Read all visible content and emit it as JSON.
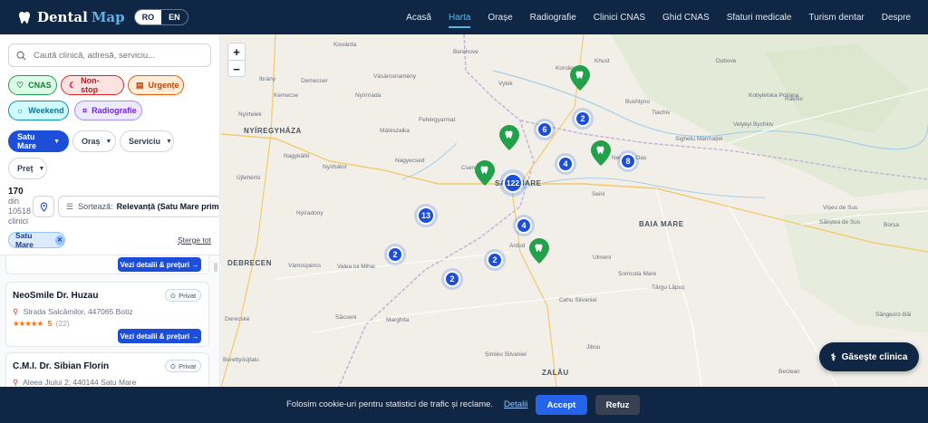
{
  "header": {
    "logo_dental": "Dental",
    "logo_map": "Map",
    "lang_ro": "RO",
    "lang_en": "EN",
    "nav": [
      "Acasă",
      "Harta",
      "Orașe",
      "Radiografie",
      "Clinici CNAS",
      "Ghid CNAS",
      "Sfaturi medicale",
      "Turism dentar",
      "Despre"
    ],
    "active_nav": "Harta"
  },
  "sidebar": {
    "search_placeholder": "Caută clinică, adresă, serviciu...",
    "chips": {
      "cnas": "CNAS",
      "nonstop": "Non-stop",
      "urgente": "Urgențe",
      "weekend": "Weekend",
      "radiografie": "Radiografie"
    },
    "filters": {
      "judet": "Satu Mare",
      "oras": "Oraș",
      "serviciu": "Serviciu",
      "pret": "Preț"
    },
    "count": {
      "num": "170",
      "din": "din",
      "total": "10518",
      "unit": "clinici"
    },
    "sort_label": "Sortează:",
    "sort_value": "Relevanță (Satu Mare primele)",
    "active_tag": "Satu Mare",
    "clear_all": "Șterge tot",
    "cards": [
      {
        "button": "Vezi detalii & prețuri →"
      },
      {
        "name": "NeoSmile Dr. Huzau",
        "badge": "Privat",
        "address": "Strada Salcâmilor, 447065 Botiz",
        "stars": "★★★★★",
        "rating": "5",
        "reviews": "(22)",
        "button": "Vezi detalii & prețuri →"
      },
      {
        "name": "C.M.I. Dr. Sibian Florin",
        "badge": "Privat",
        "address": "Aleea Jiului 2, 440144 Satu Mare"
      }
    ]
  },
  "map": {
    "zoom_in": "+",
    "zoom_out": "−",
    "cities": [
      "NYÍREGYHÁZA",
      "SATU MARE",
      "BAIA MARE",
      "DEBRECEN",
      "ZALĂU"
    ],
    "places": [
      "Kisvárda",
      "Berehove",
      "Khust",
      "Dubove",
      "Ibrány",
      "Demecser",
      "Vásárosnamény",
      "Korolevo",
      "Vylok",
      "Kemecse",
      "Nyírmada",
      "Bushtyno",
      "Kobyletska Poliana",
      "Rakhiv",
      "Nyírtelek",
      "Mátészalka",
      "Fehérgyarmat",
      "Tiachiv",
      "Velykyi Bychkiv",
      "Sighetu Marmației",
      "Nagykálló",
      "Nagyecsed",
      "Csenger",
      "Negrești-Oaș",
      "Nyírbátor",
      "Újfehértó",
      "Seini",
      "Vișeu de Sus",
      "Nyíradony",
      "Săliștea de Sus",
      "Borșa",
      "Vámospércs",
      "Valea lui Mihai",
      "Ardud",
      "Derecske",
      "Săcueni",
      "Marghita",
      "Ulmeni",
      "Șomcuta Mare",
      "Târgu Lăpuș",
      "Cehu Silvaniei",
      "Săngeorz-Băi",
      "Jibou",
      "Șimleu Silvaniei",
      "Berettyóújfalu",
      "Beclean"
    ],
    "clusters": [
      "6",
      "2",
      "4",
      "8",
      "122",
      "13",
      "4",
      "2",
      "2",
      "2"
    ],
    "find_button": "Găsește clinica"
  },
  "cookie": {
    "message": "Folosim cookie-uri pentru statistici de trafic și reclame.",
    "details": "Detalii",
    "accept": "Accept",
    "refuse": "Refuz"
  }
}
